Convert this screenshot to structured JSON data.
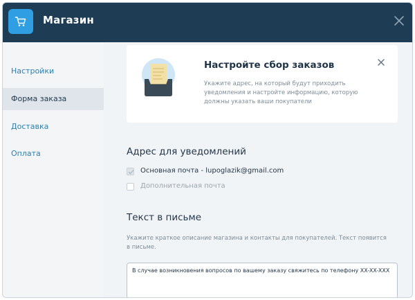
{
  "app": {
    "title": "Магазин"
  },
  "sidebar": {
    "items": [
      {
        "label": "Настройки",
        "active": false
      },
      {
        "label": "Форма заказа",
        "active": true
      },
      {
        "label": "Доставка",
        "active": false
      },
      {
        "label": "Оплата",
        "active": false
      }
    ]
  },
  "banner": {
    "title": "Настройте сбор заказов",
    "description": "Укажите адрес, на который будут приходить уведомления и настройте информацию, которую должны указать ваши покупатели"
  },
  "notifications": {
    "title": "Адрес для уведомлений",
    "primary": {
      "label": "Основная почта - lupoglazik@gmail.com",
      "checked": true
    },
    "secondary": {
      "label": "Дополнительная почта",
      "checked": false
    }
  },
  "letter": {
    "title": "Текст в письме",
    "hint": "Укажите краткое описание магазина и контакты для покупателей. Текст появится в письме.",
    "value": "В случае возникновения вопросов по вашему заказу свяжитесь по телефону XX-XX-XXX"
  },
  "colors": {
    "header_bg": "#1e3d55",
    "accent": "#2f9ee2",
    "sidebar_link": "#2d7fb0"
  }
}
